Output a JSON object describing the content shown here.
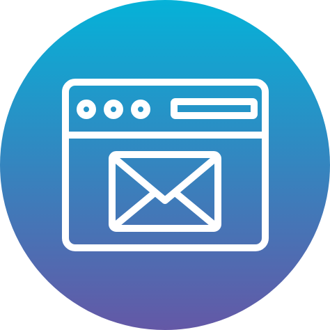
{
  "icon": {
    "name": "browser-mail-icon",
    "badge_shape": "circle",
    "gradient_top": "#05B2D8",
    "gradient_bottom": "#6458A6",
    "stroke_color": "#FFFFFF"
  }
}
